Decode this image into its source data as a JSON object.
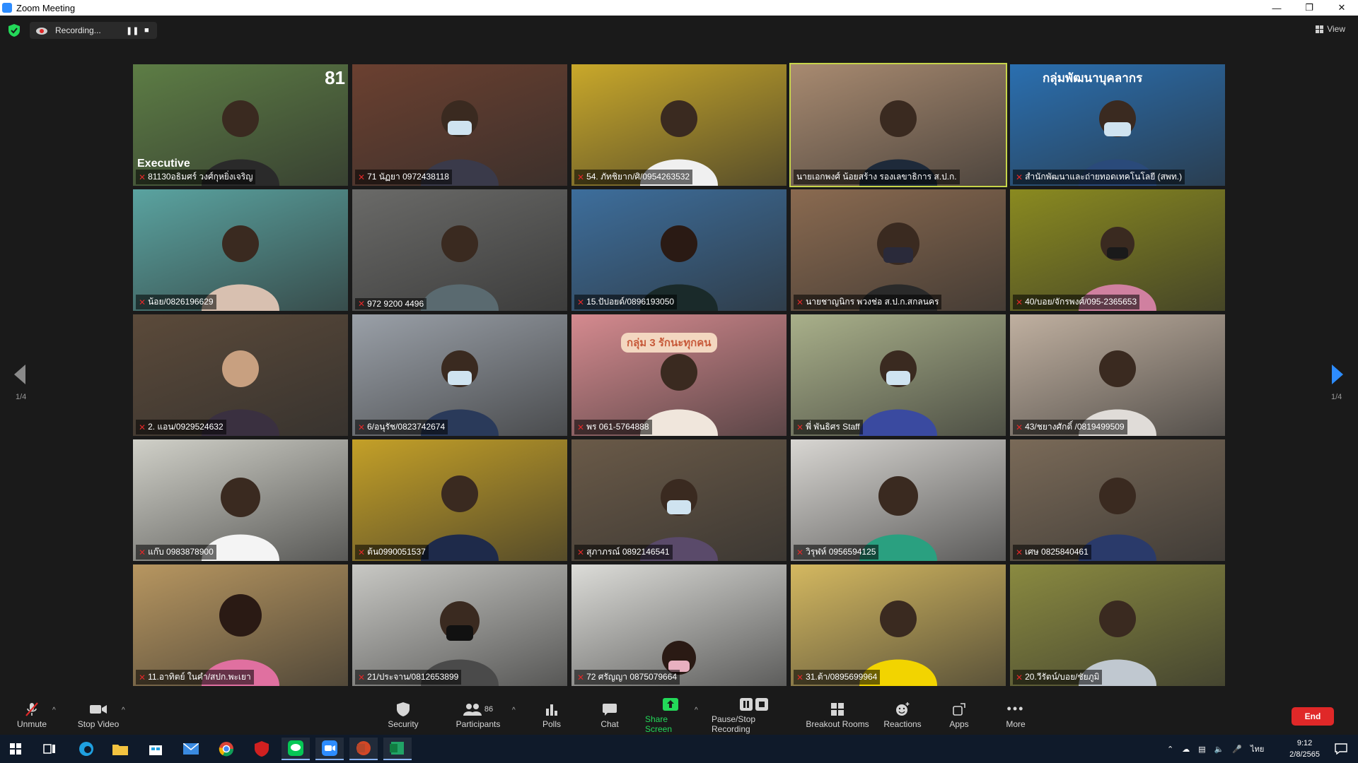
{
  "window": {
    "title": "Zoom Meeting"
  },
  "meeting_bar": {
    "recording_label": "Recording...",
    "view_label": "View"
  },
  "pagination": {
    "left": "1/4",
    "right": "1/4"
  },
  "tiles": [
    {
      "label": "81130อธิมศร์ วงศ์กุหยิ่งเจริญ",
      "overlay_logo": "81",
      "overlay_tag": "Executive",
      "bg": "#5d7d45"
    },
    {
      "label": "71 นัฏยา 0972438118",
      "bg": "#6b4030"
    },
    {
      "label": "54. ภัทชิยาก/ศิ/0954263532",
      "bg": "#c9a82a"
    },
    {
      "label": "นายเอกพงศ์ น้อยสร้าง รองเลขาธิการ ส.ป.ก.",
      "bg": "#a88a70"
    },
    {
      "label": "สำนักพัฒนาและถ่ายทอดเทคโนโลยี (สพท.)",
      "overlay_title": "กลุ่มพัฒนาบุคลากร",
      "bg": "#2a6fb0"
    },
    {
      "label": "น้อย/0826196629",
      "bg": "#5aa3a0"
    },
    {
      "label": "972 9200 4496",
      "bg": "#6a6a68"
    },
    {
      "label": "15.ปัปอยด์/0896193050",
      "bg": "#3d6e9c"
    },
    {
      "label": "นายชาญนิกร พวงช่อ ส.ป.ก.สกลนคร",
      "bg": "#8a6a50"
    },
    {
      "label": "40/บอย/จักรพงศ์/095-2365653",
      "bg": "#8a8a20"
    },
    {
      "label": "2. แอน/0929524632",
      "bg": "#5b4a3a"
    },
    {
      "label": "6/อนุรัช/0823742674",
      "bg": "#9aa0a8"
    },
    {
      "label": "พร 061-5764888",
      "overlay_title": "กลุ่ม 3 รักนะทุกคน",
      "bg": "#d58a8f"
    },
    {
      "label": "พี่ พันธิศร Staff",
      "bg": "#a9b08a"
    },
    {
      "label": "43/ชยางศักดิ์ /0819499509",
      "bg": "#c0b0a0"
    },
    {
      "label": "แก๊บ 0983878900",
      "bg": "#d0d0c8"
    },
    {
      "label": "ต้น0990051537",
      "bg": "#c4a028"
    },
    {
      "label": "สุภาภรณ์ 0892146541",
      "bg": "#6a5a48"
    },
    {
      "label": "วิรุฬห์ 0956594125",
      "bg": "#d8d6d2"
    },
    {
      "label": "เศษ 0825840461",
      "bg": "#7a6a58"
    },
    {
      "label": "11.อาทิตย์ ในคำ/สปก.พะเยา",
      "bg": "#b79660"
    },
    {
      "label": "21/ประจาน/0812653899",
      "bg": "#c8c8c4"
    },
    {
      "label": "72 ศรัญญา 0875079664",
      "bg": "#dcdcd8"
    },
    {
      "label": "31.ต้า/0895699964",
      "bg": "#d4b860"
    },
    {
      "label": "20.วีรัตน์/บอย/ชัยภูมิ",
      "bg": "#8a8a40"
    }
  ],
  "toolbar": {
    "unmute": "Unmute",
    "stop_video": "Stop Video",
    "security": "Security",
    "participants": "Participants",
    "participants_count": "86",
    "polls": "Polls",
    "chat": "Chat",
    "share_screen": "Share Screen",
    "pause_stop_recording": "Pause/Stop Recording",
    "breakout_rooms": "Breakout Rooms",
    "reactions": "Reactions",
    "apps": "Apps",
    "more": "More",
    "end": "End"
  },
  "taskbar": {
    "time": "9:12",
    "date": "2/8/2565",
    "lang": "ไทย"
  },
  "colors": {
    "active_speaker": "#c7d44a",
    "accent_green": "#23d959",
    "end_red": "#e02828",
    "mic_red": "#e02828"
  }
}
